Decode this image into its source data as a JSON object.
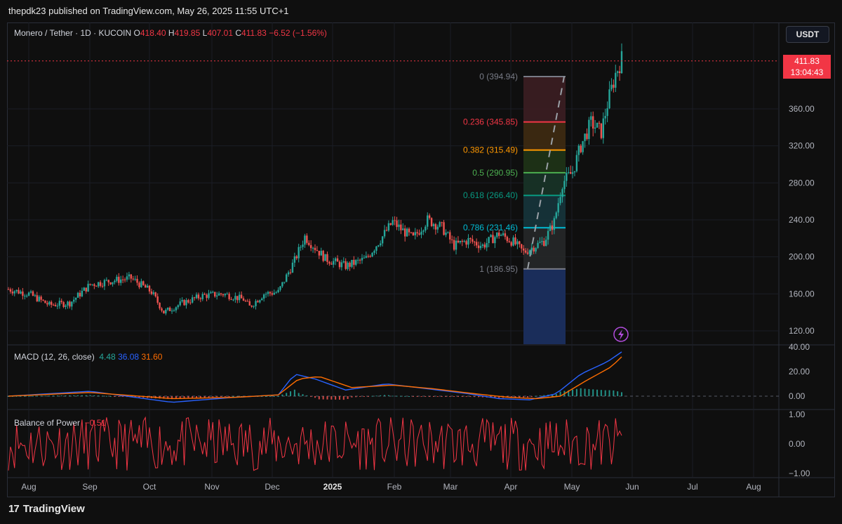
{
  "header": {
    "publish_line": "thepdk23 published on TradingView.com, May 26, 2025 11:55 UTC+1"
  },
  "symbol": {
    "title": "Monero / Tether · 1D · KUCOIN",
    "open_label": "O",
    "open": "418.40",
    "high_label": "H",
    "high": "419.85",
    "low_label": "L",
    "low": "407.01",
    "close_label": "C",
    "close": "411.83",
    "change": "−6.52 (−1.56%)"
  },
  "currency_button": "USDT",
  "price_tag": {
    "price": "411.83",
    "countdown": "13:04:43"
  },
  "macd": {
    "label": "MACD (12, 26, close)",
    "hist": "4.48",
    "macd": "36.08",
    "signal": "31.60",
    "colors": {
      "macd": "#2962ff",
      "signal": "#ff6d00",
      "hist_up": "#26a69a",
      "hist_down": "#ef5350"
    }
  },
  "bop": {
    "label": "Balance of Power",
    "value": "−0.51",
    "color": "#f23645"
  },
  "fib": {
    "levels": [
      {
        "ratio": "0",
        "label": "0 (394.94)",
        "price": 394.94,
        "color": "#787b86"
      },
      {
        "ratio": "0.236",
        "label": "0.236 (345.85)",
        "price": 345.85,
        "color": "#f23645"
      },
      {
        "ratio": "0.382",
        "label": "0.382 (315.49)",
        "price": 315.49,
        "color": "#ff9800"
      },
      {
        "ratio": "0.5",
        "label": "0.5 (290.95)",
        "price": 290.95,
        "color": "#4caf50"
      },
      {
        "ratio": "0.618",
        "label": "0.618 (266.40)",
        "price": 266.4,
        "color": "#089981"
      },
      {
        "ratio": "0.786",
        "label": "0.786 (231.46)",
        "price": 231.46,
        "color": "#00bcd4"
      },
      {
        "ratio": "1",
        "label": "1 (186.95)",
        "price": 186.95,
        "color": "#787b86"
      }
    ]
  },
  "footer": {
    "logo": "17",
    "brand": "TradingView"
  },
  "chart_data": {
    "type": "candlestick",
    "title": "Monero / Tether · 1D · KUCOIN",
    "x_axis_ticks": [
      "Aug",
      "Sep",
      "Oct",
      "Nov",
      "Dec",
      "2025",
      "Feb",
      "Mar",
      "Apr",
      "May",
      "Jun",
      "Jul",
      "Aug"
    ],
    "y_axis_ticks": [
      "360.00",
      "320.00",
      "280.00",
      "240.00",
      "200.00",
      "160.00",
      "120.00"
    ],
    "macd_axis_ticks": [
      "40.00",
      "20.00",
      "0.00"
    ],
    "bop_axis_ticks": [
      "1.00",
      "0.00",
      "−1.00"
    ],
    "ylim": [
      105,
      420
    ],
    "price_path": [
      [
        0,
        165
      ],
      [
        10,
        160
      ],
      [
        20,
        148
      ],
      [
        30,
        150
      ],
      [
        40,
        170
      ],
      [
        50,
        174
      ],
      [
        60,
        177
      ],
      [
        70,
        162
      ],
      [
        76,
        140
      ],
      [
        85,
        150
      ],
      [
        95,
        158
      ],
      [
        105,
        160
      ],
      [
        115,
        154
      ],
      [
        118,
        146
      ],
      [
        125,
        160
      ],
      [
        132,
        162
      ],
      [
        140,
        196
      ],
      [
        145,
        222
      ],
      [
        155,
        198
      ],
      [
        165,
        190
      ],
      [
        175,
        198
      ],
      [
        183,
        222
      ],
      [
        188,
        238
      ],
      [
        192,
        230
      ],
      [
        198,
        220
      ],
      [
        205,
        240
      ],
      [
        212,
        232
      ],
      [
        218,
        212
      ],
      [
        225,
        218
      ],
      [
        232,
        212
      ],
      [
        240,
        225
      ],
      [
        247,
        216
      ],
      [
        252,
        205
      ],
      [
        262,
        217
      ],
      [
        267,
        238
      ],
      [
        271,
        280
      ],
      [
        276,
        292
      ],
      [
        280,
        320
      ],
      [
        285,
        345
      ],
      [
        290,
        335
      ],
      [
        293,
        365
      ],
      [
        297,
        398
      ],
      [
        300,
        414
      ]
    ],
    "macd_path": [
      [
        0,
        0
      ],
      [
        40,
        4
      ],
      [
        80,
        -5
      ],
      [
        110,
        -1
      ],
      [
        132,
        1
      ],
      [
        140,
        18
      ],
      [
        150,
        14
      ],
      [
        165,
        5
      ],
      [
        185,
        10
      ],
      [
        205,
        6
      ],
      [
        225,
        2
      ],
      [
        240,
        -2
      ],
      [
        255,
        -3
      ],
      [
        268,
        2
      ],
      [
        280,
        18
      ],
      [
        293,
        28
      ],
      [
        300,
        36
      ]
    ],
    "signal_path": [
      [
        0,
        0
      ],
      [
        40,
        3
      ],
      [
        80,
        -2
      ],
      [
        110,
        -1
      ],
      [
        132,
        1
      ],
      [
        142,
        14
      ],
      [
        152,
        16
      ],
      [
        168,
        7
      ],
      [
        188,
        9
      ],
      [
        208,
        6
      ],
      [
        228,
        2
      ],
      [
        245,
        -1
      ],
      [
        258,
        -2
      ],
      [
        270,
        0
      ],
      [
        282,
        12
      ],
      [
        295,
        24
      ],
      [
        300,
        32
      ]
    ]
  }
}
